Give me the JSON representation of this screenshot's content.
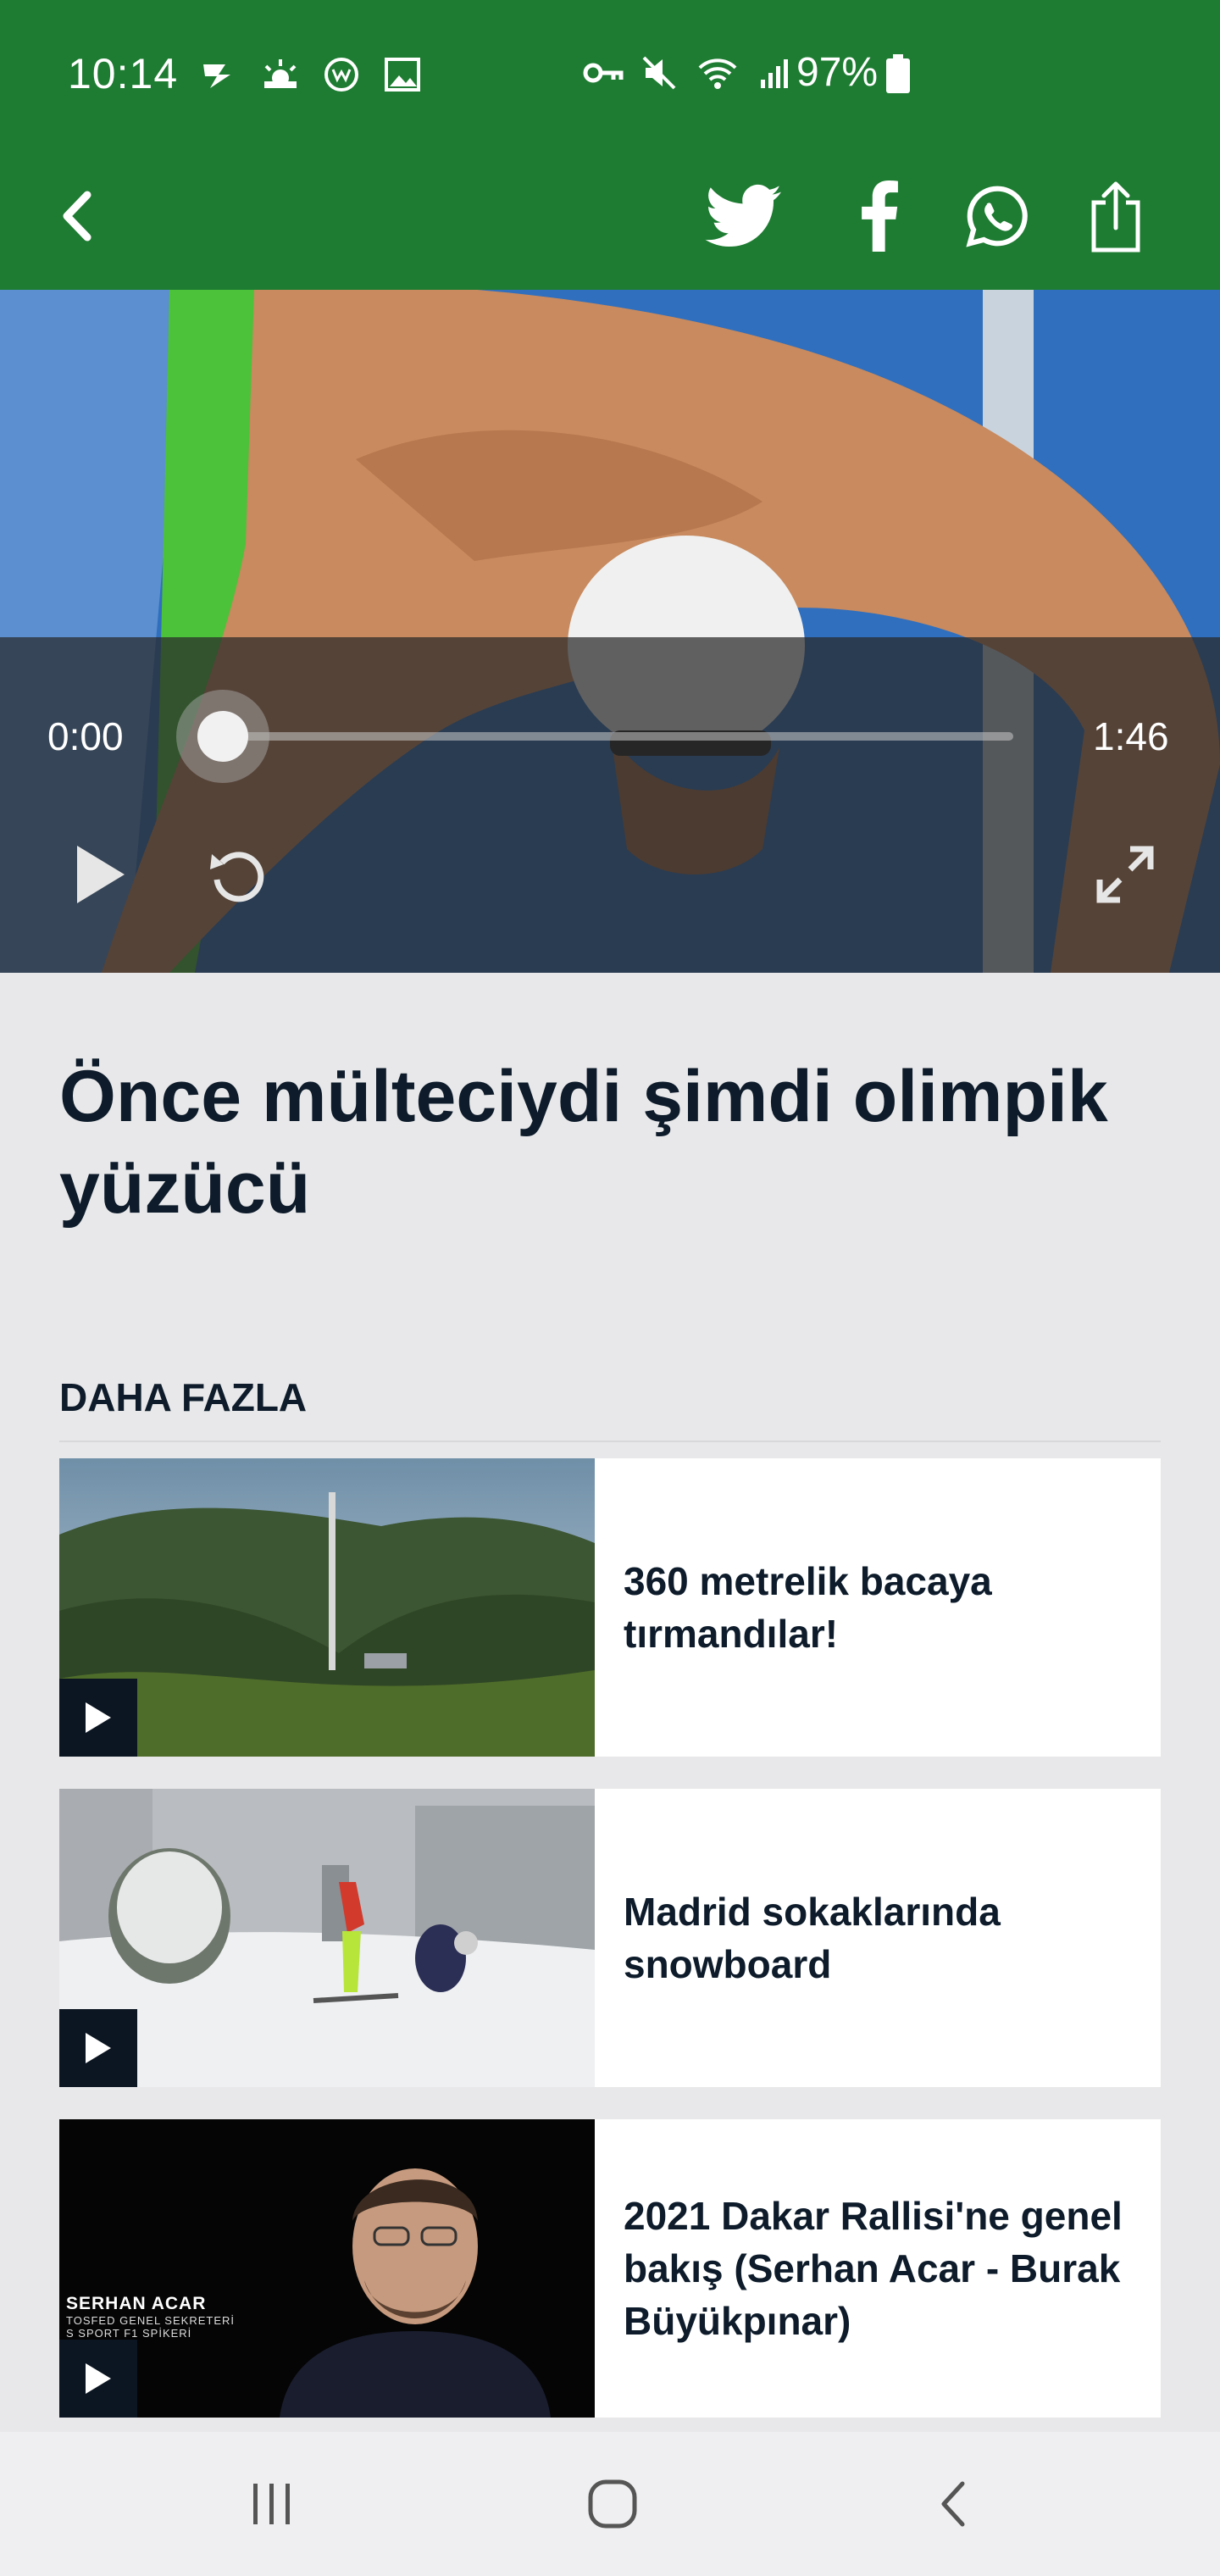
{
  "status_bar": {
    "time": "10:14",
    "battery_percent": "97%",
    "left_icons": [
      "notification-icon",
      "weather-icon",
      "app-badge-icon",
      "image-icon"
    ],
    "right_icons": [
      "key-icon",
      "mute-icon",
      "wifi-icon",
      "signal-icon",
      "battery-icon"
    ]
  },
  "toolbar": {
    "back_icon": "back-chevron-icon",
    "share_buttons": [
      "twitter-icon",
      "facebook-icon",
      "whatsapp-icon",
      "share-icon"
    ],
    "background_color": "#1e7c32"
  },
  "video": {
    "current_time": "0:00",
    "duration": "1:46",
    "progress": 0.0
  },
  "article": {
    "title": "Önce mülteciydi şimdi olimpik yüzücü"
  },
  "more_section": {
    "heading": "DAHA FAZLA",
    "items": [
      {
        "title": "360 metrelik bacaya tırmandılar!",
        "thumb": "mountain-chimney"
      },
      {
        "title": "Madrid sokaklarında snowboard",
        "thumb": "snow-street"
      },
      {
        "title": "2021 Dakar Rallisi'ne genel bakış (Serhan Acar - Burak Büyükpınar)",
        "thumb": "presenter",
        "thumb_caption_name": "SERHAN ACAR",
        "thumb_caption_role1": "TOSFED GENEL SEKRETERİ",
        "thumb_caption_role2": "S SPORT F1 SPİKERİ"
      }
    ]
  },
  "nav_bar": {
    "buttons": [
      "recents-icon",
      "home-icon",
      "nav-back-icon"
    ]
  }
}
